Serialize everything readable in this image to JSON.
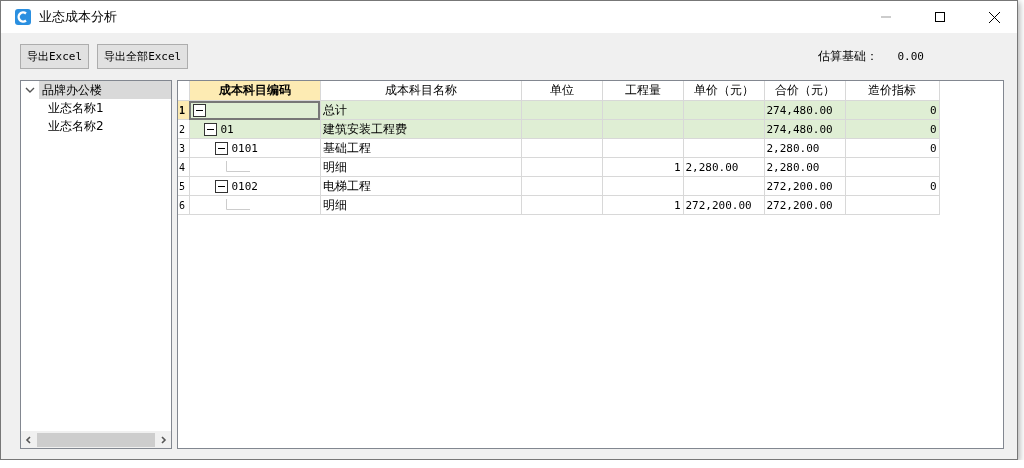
{
  "window": {
    "title": "业态成本分析"
  },
  "toolbar": {
    "buttons": [
      "导出Excel",
      "导出全部Excel"
    ],
    "estimate_label": "估算基础：",
    "estimate_value": "0.00"
  },
  "sidebar": {
    "items": [
      {
        "label": "品牌办公楼",
        "expanded": true,
        "selected": true,
        "children": [
          {
            "label": "业态名称1",
            "selected": false
          },
          {
            "label": "业态名称2",
            "selected": false
          }
        ]
      }
    ]
  },
  "table": {
    "columns": [
      {
        "label": "成本科目编码",
        "selected": true
      },
      {
        "label": "成本科目名称",
        "selected": false
      },
      {
        "label": "单位",
        "selected": false
      },
      {
        "label": "工程量",
        "selected": false
      },
      {
        "label": "单价（元）",
        "selected": false
      },
      {
        "label": "合价（元）",
        "selected": false
      },
      {
        "label": "造价指标",
        "selected": false
      }
    ],
    "rows": [
      {
        "number": "1",
        "selected": true,
        "highlighted": true,
        "expanded": true,
        "name": "总计",
        "total": "274,480.00",
        "cost_index": "0",
        "children": [
          {
            "number": "2",
            "selected": false,
            "highlighted": true,
            "expanded": true,
            "code": "01",
            "name": "建筑安装工程费",
            "total": "274,480.00",
            "cost_index": "0",
            "children": [
              {
                "number": "3",
                "selected": false,
                "highlighted": false,
                "expanded": true,
                "code": "0101",
                "name": "基础工程",
                "total": "2,280.00",
                "cost_index": "0",
                "children": [
                  {
                    "number": "4",
                    "selected": false,
                    "highlighted": false,
                    "name": "明细",
                    "quantity": "1",
                    "unit_price": "2,280.00",
                    "total": "2,280.00"
                  }
                ]
              },
              {
                "number": "5",
                "selected": false,
                "highlighted": false,
                "expanded": true,
                "code": "0102",
                "name": "电梯工程",
                "total": "272,200.00",
                "cost_index": "0",
                "children": [
                  {
                    "number": "6",
                    "selected": false,
                    "highlighted": false,
                    "name": "明细",
                    "quantity": "1",
                    "unit_price": "272,200.00",
                    "total": "272,200.00"
                  }
                ]
              }
            ]
          }
        ]
      }
    ]
  }
}
